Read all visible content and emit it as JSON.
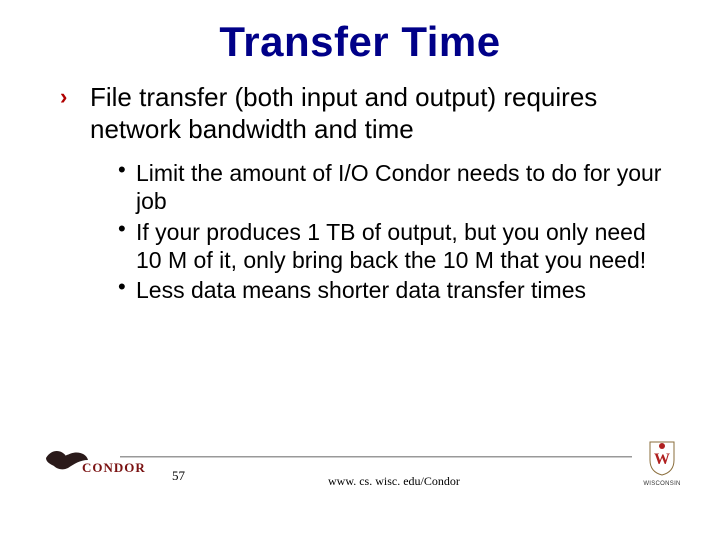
{
  "title": "Transfer Time",
  "main_bullet": "File transfer (both input and output) requires network bandwidth and time",
  "sub_bullets": {
    "b1": "Limit the amount of I/O Condor needs to do for your job",
    "b2": "If your produces 1 TB of output, but you only need 10 M of it, only bring back the 10 M that you need!",
    "b3": "Less data means shorter data transfer times"
  },
  "footer": {
    "slide_number": "57",
    "url": "www. cs. wisc. edu/Condor",
    "condor_name": "CONDOR",
    "wisc_name": "WISCONSIN"
  }
}
